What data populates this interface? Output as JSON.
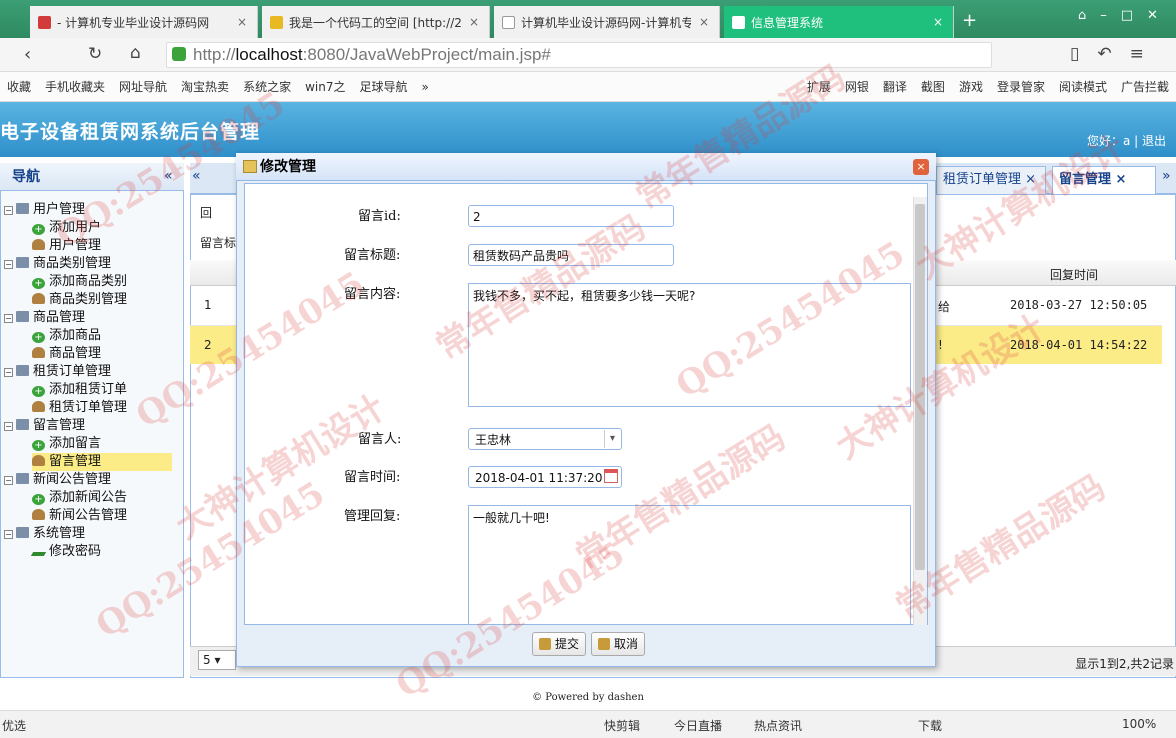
{
  "browser": {
    "tabs": [
      {
        "title": "- 计算机专业毕业设计源码网"
      },
      {
        "title": "我是一个代码工的空间 [http://2"
      },
      {
        "title": "计算机毕业设计源码网-计算机专"
      },
      {
        "title": "信息管理系统"
      }
    ],
    "new_tab": "+",
    "url_prefix": "http://",
    "url_host": "localhost",
    "url_rest": ":8080/JavaWebProject/main.jsp#",
    "bookmarks": [
      "收藏",
      "手机收藏夹",
      "网址导航",
      "淘宝热卖",
      "系统之家",
      "win7之",
      "足球导航",
      "»"
    ],
    "toolbar_right": [
      "扩展",
      "网银",
      "翻译",
      "截图",
      "游戏",
      "登录管家",
      "阅读模式",
      "广告拦截"
    ]
  },
  "app": {
    "title": "电子设备租赁网系统后台管理",
    "greeting": "您好：a",
    "logout": "退出",
    "footer": "© Powered by dashen"
  },
  "nav": {
    "title": "导航",
    "collapse": "«",
    "groups": [
      {
        "label": "用户管理",
        "items": [
          "添加用户",
          "用户管理"
        ]
      },
      {
        "label": "商品类别管理",
        "items": [
          "添加商品类别",
          "商品类别管理"
        ]
      },
      {
        "label": "商品管理",
        "items": [
          "添加商品",
          "商品管理"
        ]
      },
      {
        "label": "租赁订单管理",
        "items": [
          "添加租赁订单",
          "租赁订单管理"
        ]
      },
      {
        "label": "留言管理",
        "items": [
          "添加留言",
          "留言管理"
        ]
      },
      {
        "label": "新闻公告管理",
        "items": [
          "添加新闻公告",
          "新闻公告管理"
        ]
      },
      {
        "label": "系统管理",
        "items": [
          "修改密码"
        ]
      }
    ]
  },
  "main": {
    "tabs": [
      "租赁订单管理",
      "留言管理"
    ],
    "toolbar_btn": "回",
    "filter_label": "留言标",
    "column_reply_time": "回复时间",
    "rows": [
      {
        "num": "1",
        "frag": "给",
        "time": "2018-03-27 12:50:05"
      },
      {
        "num": "2",
        "frag": "!",
        "time": "2018-04-01 14:54:22"
      }
    ],
    "page_size": "5",
    "pager_info": "显示1到2,共2记录"
  },
  "dialog": {
    "title": "修改管理",
    "close": "×",
    "fields": {
      "id_label": "留言id:",
      "id_value": "2",
      "title_label": "留言标题:",
      "title_value": "租赁数码产品贵吗",
      "content_label": "留言内容:",
      "content_value": "我钱不多，买不起，租赁要多少钱一天呢?",
      "author_label": "留言人:",
      "author_value": "王忠林",
      "time_label": "留言时间:",
      "time_value": "2018-04-01 11:37:20",
      "reply_label": "管理回复:",
      "reply_value": "一般就几十吧!"
    },
    "submit": "提交",
    "cancel": "取消"
  },
  "status": {
    "left": "优选",
    "items": [
      "快剪辑",
      "今日直播",
      "热点资讯",
      "下载"
    ],
    "zoom": "100%"
  },
  "watermarks": [
    "QQ:25454045",
    "常年售精品源码",
    "大神计算机设计",
    "QQ:25454045",
    "常年售精品源码",
    "大神计算机设计",
    "QQ:25454045",
    "常年售精品源码"
  ]
}
